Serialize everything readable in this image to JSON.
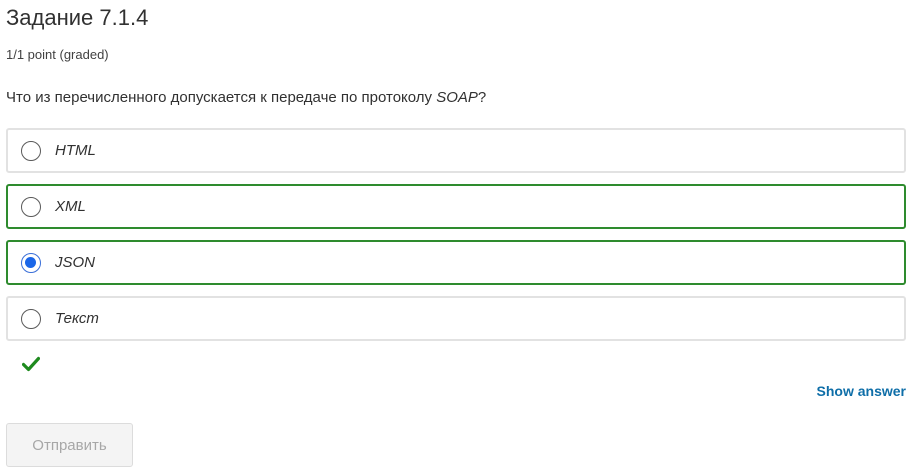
{
  "problem": {
    "title": "Задание 7.1.4",
    "score": "1/1 point (graded)",
    "question_prefix": "Что из перечисленного допускается к передаче по протоколу ",
    "question_term": "SOAP",
    "question_suffix": "?"
  },
  "choices": [
    {
      "label": "HTML",
      "selected": false,
      "status": "neutral"
    },
    {
      "label": "XML",
      "selected": false,
      "status": "correct"
    },
    {
      "label": "JSON",
      "selected": true,
      "status": "correct"
    },
    {
      "label": "Текст",
      "selected": false,
      "status": "neutral"
    }
  ],
  "result": {
    "icon": "checkmark-icon",
    "color": "#1e8a1e"
  },
  "actions": {
    "show_answer_label": "Show answer",
    "submit_label": "Отправить"
  },
  "colors": {
    "correct_border": "#2e8b2e",
    "neutral_border": "#e2e2e2",
    "link": "#0e6ea8",
    "radio_selected": "#1a66e8"
  }
}
